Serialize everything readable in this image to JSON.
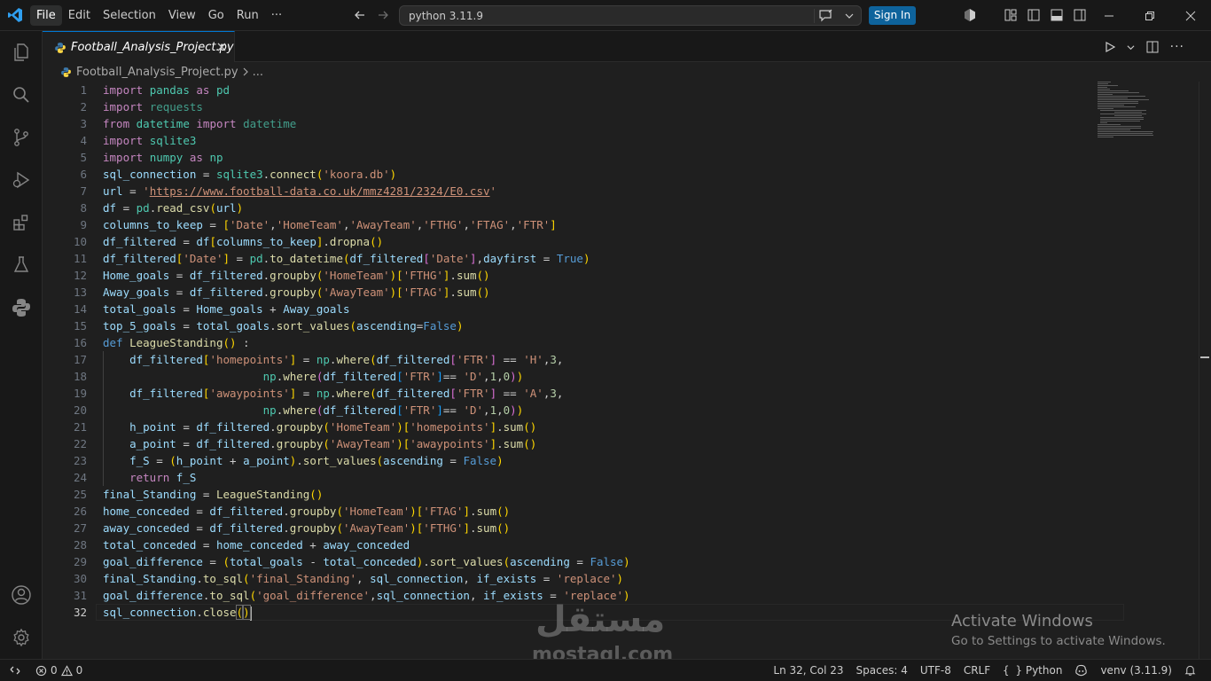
{
  "titlebar": {
    "menu": [
      "File",
      "Edit",
      "Selection",
      "View",
      "Go",
      "Run",
      "···"
    ],
    "command_center": "python 3.11.9",
    "sign_in": "Sign In"
  },
  "tab": {
    "filename": "Football_Analysis_Project.py"
  },
  "breadcrumb": {
    "file": "Football_Analysis_Project.py",
    "more": "..."
  },
  "editor": {
    "line_numbers": [
      "1",
      "2",
      "3",
      "4",
      "5",
      "6",
      "7",
      "8",
      "9",
      "10",
      "11",
      "12",
      "13",
      "14",
      "15",
      "16",
      "17",
      "18",
      "19",
      "20",
      "21",
      "22",
      "23",
      "24",
      "25",
      "26",
      "27",
      "28",
      "29",
      "30",
      "31",
      "32"
    ],
    "current_line": 32
  },
  "watermark": {
    "activate_title": "Activate Windows",
    "activate_sub": "Go to Settings to activate Windows.",
    "brand_ar": "مستقل",
    "brand_lat": "mostaql.com"
  },
  "statusbar": {
    "errors": "0",
    "warnings": "0",
    "position": "Ln 32, Col 23",
    "spaces": "Spaces: 4",
    "encoding": "UTF-8",
    "eol": "CRLF",
    "language": "Python",
    "interpreter": "venv (3.11.9)"
  }
}
